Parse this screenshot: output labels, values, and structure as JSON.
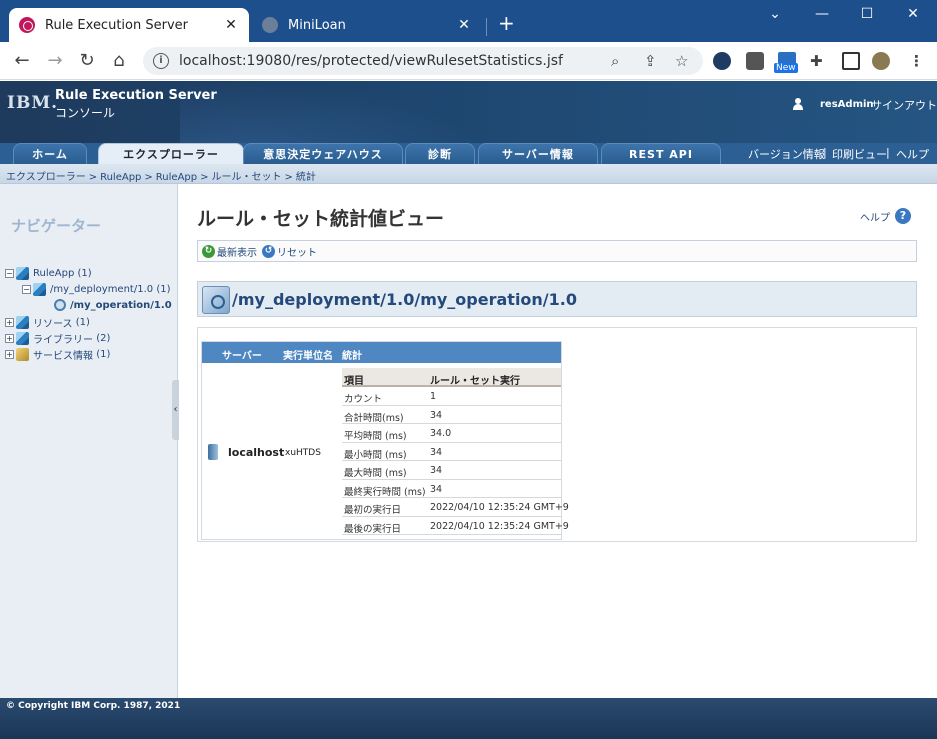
{
  "browser": {
    "tabs": [
      {
        "title": "Rule Execution Server",
        "active": true
      },
      {
        "title": "MiniLoan",
        "active": false
      }
    ],
    "url": "localhost:19080/res/protected/viewRulesetStatistics.jsf",
    "new_badge": "New"
  },
  "app": {
    "logo": "IBM.",
    "product_name": "Rule Execution Server",
    "product_sub": "コンソール",
    "user": "resAdmin",
    "signout": "サインアウト"
  },
  "nav": {
    "tabs": [
      "ホーム",
      "エクスプローラー",
      "意思決定ウェアハウス",
      "診断",
      "サーバー情報",
      "REST API"
    ],
    "active_tab": "エクスプローラー",
    "utility": {
      "version": "バージョン情報",
      "print": "印刷ビュー",
      "help": "ヘルプ",
      "sep": "|"
    }
  },
  "breadcrumb": [
    "エクスプローラー",
    ">",
    "RuleApp",
    ">",
    "RuleApp",
    ">",
    "ルール・セット",
    ">",
    "統計"
  ],
  "sidebar": {
    "title": "ナビゲーター",
    "tree": {
      "ruleapp": {
        "label": "RuleApp",
        "count": "(1)"
      },
      "deployment": {
        "label": "/my_deployment/1.0",
        "count": "(1)"
      },
      "operation": {
        "label": "/my_operation/1.0"
      },
      "resources": {
        "label": "リソース",
        "count": "(1)"
      },
      "libraries": {
        "label": "ライブラリー",
        "count": "(2)"
      },
      "services": {
        "label": "サービス情報",
        "count": "(1)"
      }
    }
  },
  "main": {
    "title": "ルール・セット統計値ビュー",
    "help": "ヘルプ",
    "actions": {
      "refresh": "最新表示",
      "reset": "リセット"
    },
    "path": "/my_deployment/1.0/my_operation/1.0",
    "table": {
      "headers": [
        "サーバー",
        "実行単位名",
        "統計"
      ],
      "server": "localhost",
      "unit": "xuHTDS",
      "stats_headers": [
        "項目",
        "ルール・セット実行"
      ],
      "stats": [
        {
          "item": "カウント",
          "value": "1"
        },
        {
          "item": "合計時間(ms)",
          "value": "34"
        },
        {
          "item": "平均時間 (ms)",
          "value": "34.0"
        },
        {
          "item": "最小時間 (ms)",
          "value": "34"
        },
        {
          "item": "最大時間 (ms)",
          "value": "34"
        },
        {
          "item": "最終実行時間 (ms)",
          "value": "34"
        },
        {
          "item": "最初の実行日",
          "value": "2022/04/10 12:35:24 GMT+9"
        },
        {
          "item": "最後の実行日",
          "value": "2022/04/10 12:35:24 GMT+9"
        }
      ]
    }
  },
  "footer": "© Copyright IBM Corp. 1987, 2021"
}
